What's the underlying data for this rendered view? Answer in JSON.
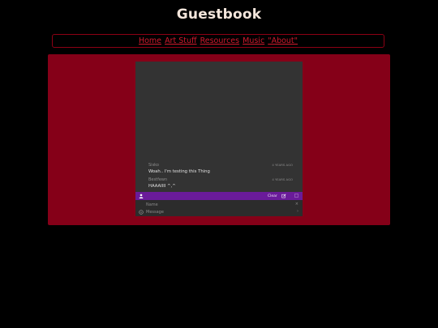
{
  "page": {
    "title": "Guestbook"
  },
  "nav": {
    "links": [
      {
        "label": "Home"
      },
      {
        "label": "Art Stuff"
      },
      {
        "label": "Resources"
      },
      {
        "label": "Music"
      },
      {
        "label": "\"About\""
      }
    ]
  },
  "chat": {
    "messages": [
      {
        "author": "Sisko",
        "time": "4 YEARS AGO",
        "text": "Woah.. I'm testing this Thing"
      },
      {
        "author": "Bestfewn",
        "time": "4 YEARS AGO",
        "text": "HAAAIIII ^,^"
      }
    ],
    "toolbar": {
      "clear_label": "Clear"
    },
    "inputs": {
      "name_placeholder": "Name",
      "message_placeholder": "Message"
    }
  },
  "colors": {
    "background": "#000000",
    "panel": "#850018",
    "nav_border": "#8c0014",
    "link": "#d11a2e",
    "chat_bg": "#333333",
    "toolbar": "#6a1b9a"
  },
  "icons": {
    "toolbar_user": "user-icon",
    "toolbar_edit": "edit-icon",
    "toolbar_box": "square-icon",
    "message_row": "smiley-icon",
    "name_action": "close-icon",
    "message_action": "send-icon"
  }
}
